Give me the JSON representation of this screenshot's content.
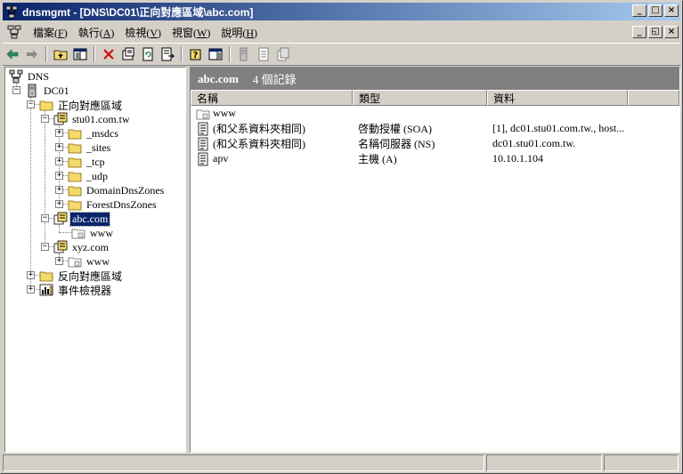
{
  "window": {
    "title": "dnsmgmt - [DNS\\DC01\\正向對應區域\\abc.com]",
    "caption_buttons": [
      "_",
      "□",
      "×"
    ],
    "mdi_buttons": [
      "_",
      "◱",
      "×"
    ]
  },
  "menu": [
    {
      "label": "檔案(",
      "acc": "F",
      "tail": ")"
    },
    {
      "label": "執行(",
      "acc": "A",
      "tail": ")"
    },
    {
      "label": "檢視(",
      "acc": "V",
      "tail": ")"
    },
    {
      "label": "視窗(",
      "acc": "W",
      "tail": ")"
    },
    {
      "label": "說明(",
      "acc": "H",
      "tail": ")"
    }
  ],
  "toolbar": {
    "buttons": [
      "back-icon",
      "forward-icon",
      "up-level-icon",
      "show-hide-tree-icon",
      "delete-icon",
      "properties-icon",
      "refresh-icon",
      "export-list-icon",
      "help-icon",
      "show-hide-action-pane-icon",
      "new-host-icon",
      "new-alias-icon",
      "new-mail-exchanger-icon"
    ]
  },
  "tree": {
    "root": "DNS",
    "server": "DC01",
    "forward_zones": "正向對應區域",
    "zone1": "stu01.com.tw",
    "zone1_children": [
      "_msdcs",
      "_sites",
      "_tcp",
      "_udp",
      "DomainDnsZones",
      "ForestDnsZones"
    ],
    "zone2": "abc.com",
    "zone2_child": "www",
    "zone3": "xyz.com",
    "zone3_child": "www",
    "reverse_zones": "反向對應區域",
    "event_viewer": "事件檢視器"
  },
  "details": {
    "zone_name": "abc.com",
    "record_count": "4 個記錄",
    "columns": [
      "名稱",
      "類型",
      "資料"
    ],
    "rows": [
      {
        "icon": "folder",
        "name": "www",
        "type": "",
        "data": ""
      },
      {
        "icon": "record",
        "name": "(和父系資料夾相同)",
        "type": "啓動授權 (SOA)",
        "data": "[1], dc01.stu01.com.tw., host..."
      },
      {
        "icon": "record",
        "name": "(和父系資料夾相同)",
        "type": "名稱伺服器 (NS)",
        "data": "dc01.stu01.com.tw."
      },
      {
        "icon": "record",
        "name": "apv",
        "type": "主機 (A)",
        "data": "10.10.1.104"
      }
    ]
  },
  "colors": {
    "title_start": "#0a246a",
    "title_end": "#a6caf0",
    "face": "#d4d0c8",
    "selection": "#0a246a",
    "header_band": "#808080"
  }
}
